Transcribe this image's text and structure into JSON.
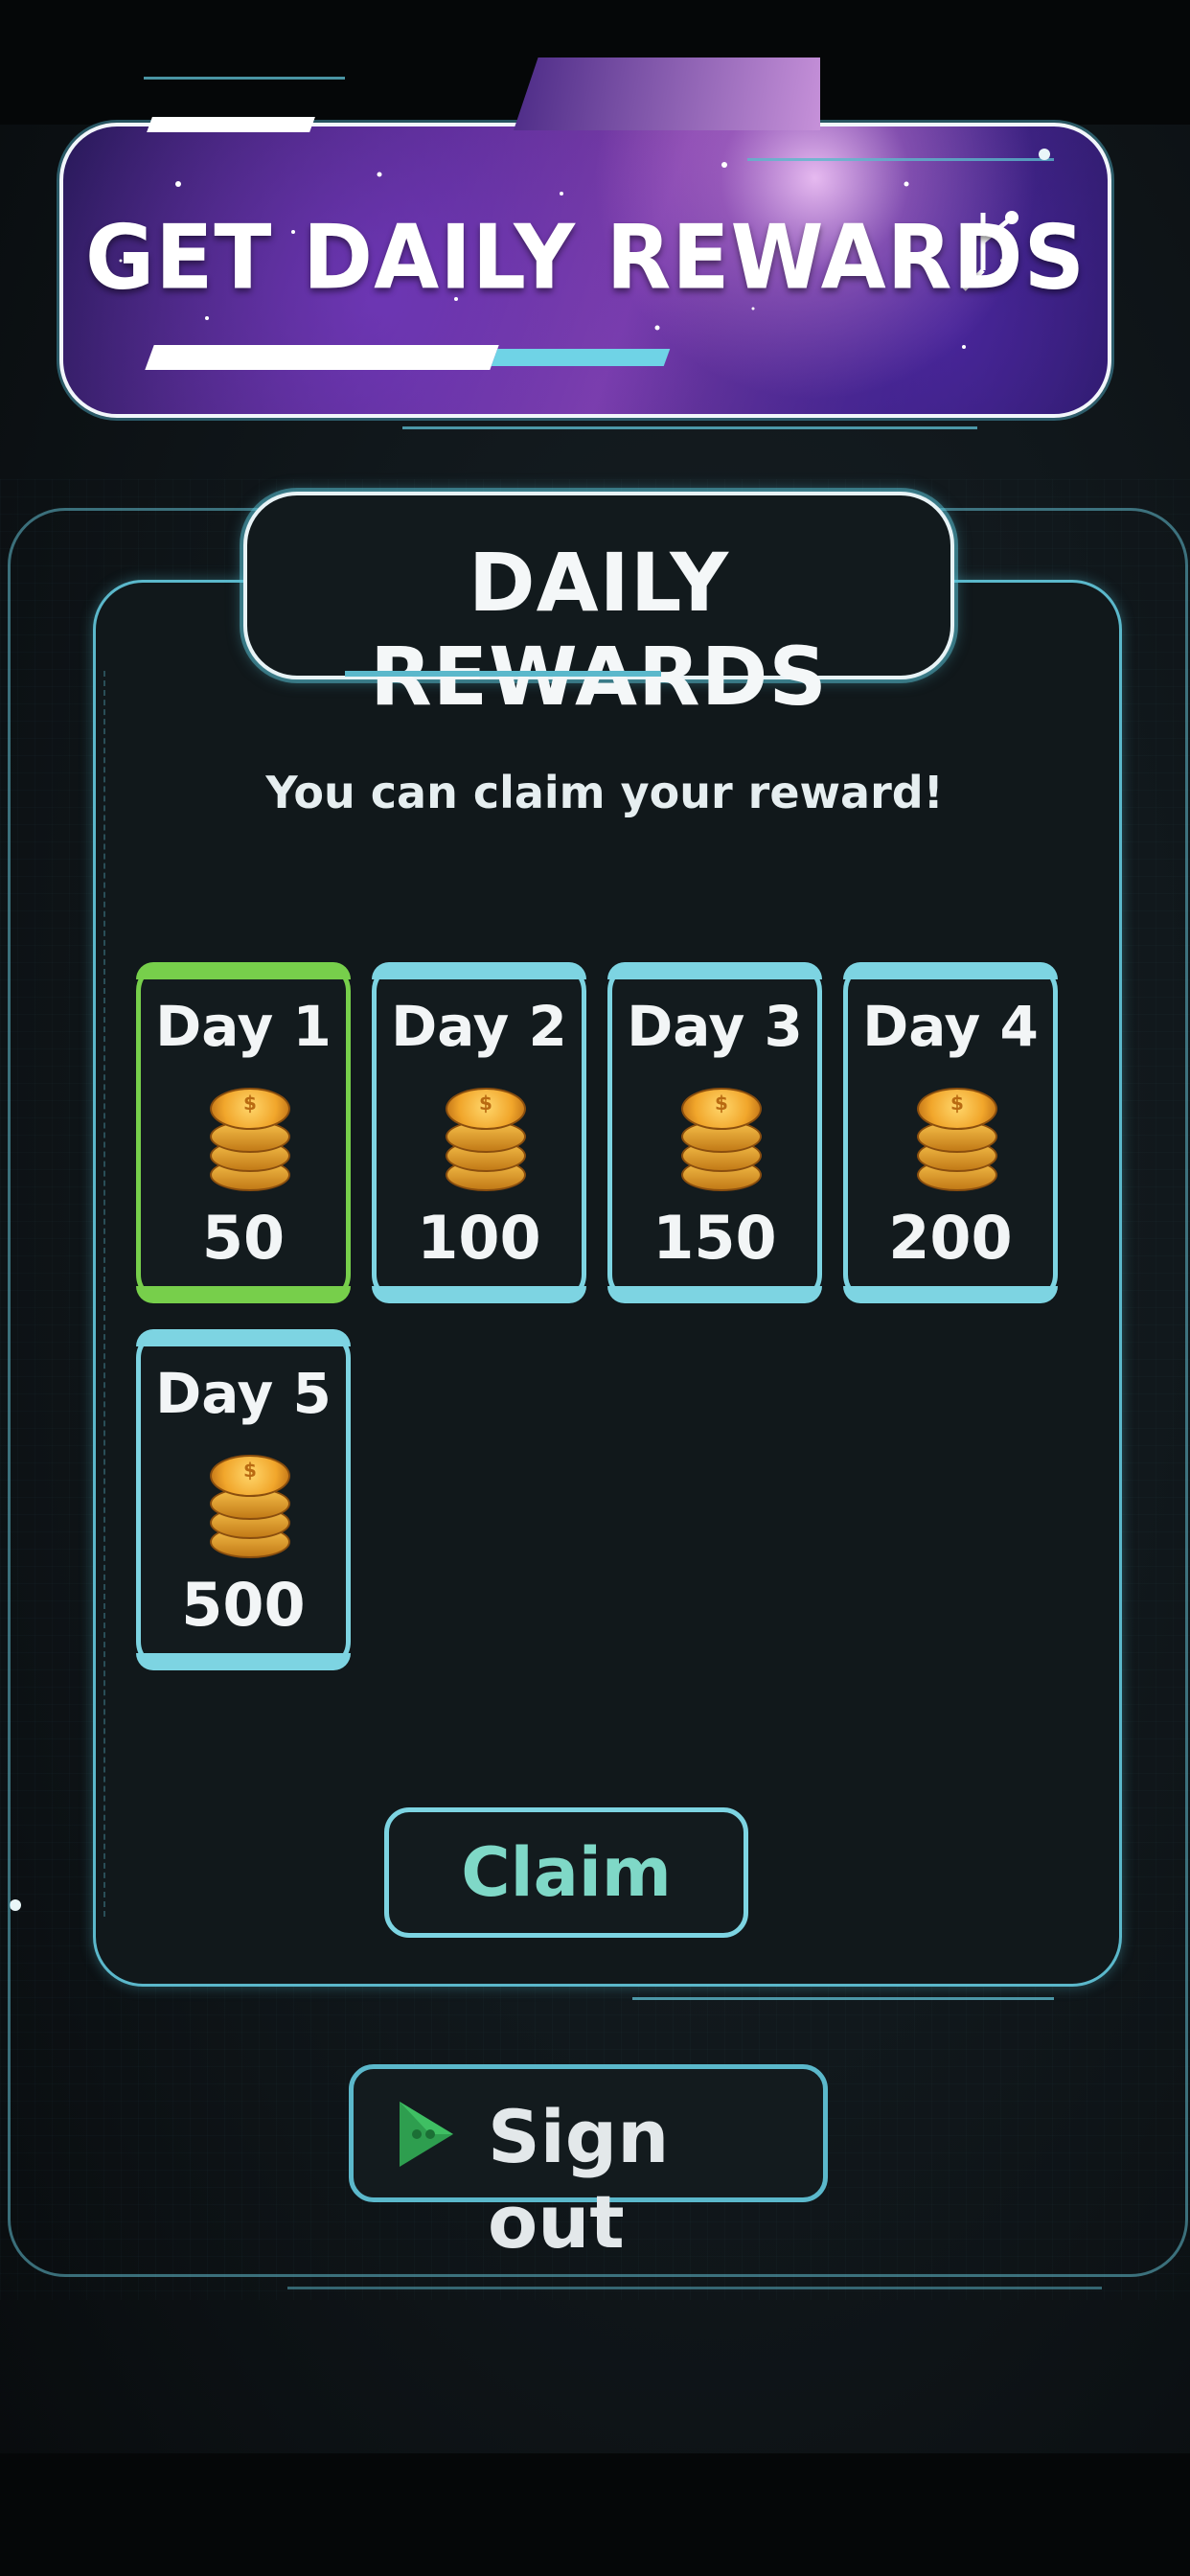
{
  "banner": {
    "title": "GET DAILY REWARDS"
  },
  "panel": {
    "title": "DAILY REWARDS",
    "subtitle": "You can claim your reward!"
  },
  "days": [
    {
      "label": "Day 1",
      "amount": "50",
      "state": "active",
      "icon": "coin-stack-icon"
    },
    {
      "label": "Day 2",
      "amount": "100",
      "state": "locked",
      "icon": "coin-stack-icon"
    },
    {
      "label": "Day 3",
      "amount": "150",
      "state": "locked",
      "icon": "coin-stack-icon"
    },
    {
      "label": "Day 4",
      "amount": "200",
      "state": "locked",
      "icon": "coin-stack-icon"
    },
    {
      "label": "Day 5",
      "amount": "500",
      "state": "locked",
      "icon": "coin-stack-icon"
    }
  ],
  "buttons": {
    "claim": "Claim",
    "sign_out": "Sign out",
    "sign_out_icon": "google-play-games-icon"
  },
  "colors": {
    "accent": "#7dd4e2",
    "active_day": "#77cf4b",
    "claim_text": "#7fd8c7",
    "panel_bg": "#11181b"
  }
}
